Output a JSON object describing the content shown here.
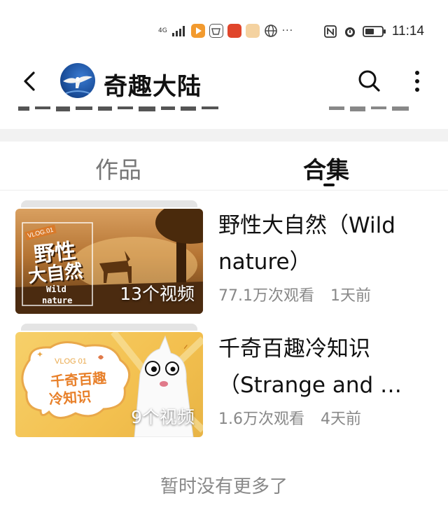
{
  "status_bar": {
    "network": "4G",
    "time": "11:14",
    "overflow": "···"
  },
  "header": {
    "title": "奇趣大陆",
    "icons": [
      "back-icon",
      "search-icon",
      "more-vertical-icon"
    ]
  },
  "tabs": [
    {
      "label": "作品",
      "active": false
    },
    {
      "label": "合集",
      "active": true
    }
  ],
  "collections": [
    {
      "thumb_badge": "VLOG.01",
      "thumb_title_1": "野性",
      "thumb_title_2": "大自然",
      "thumb_sub_1": "Wild",
      "thumb_sub_2": "nature",
      "count": "13个视频",
      "name": "野性大自然（Wild nature）",
      "views": "77.1万次观看",
      "time": "1天前"
    },
    {
      "thumb_badge": "VLOG 01",
      "thumb_title_1": "千奇百趣",
      "thumb_title_2": "冷知识",
      "count": "9个视频",
      "name": "千奇百趣冷知识（Strange and …",
      "views": "1.6万次观看",
      "time": "4天前"
    }
  ],
  "footer": "暂时没有更多了",
  "colors": {
    "accent": "#111111",
    "muted": "#888888",
    "separator": "#f2f2f2"
  }
}
